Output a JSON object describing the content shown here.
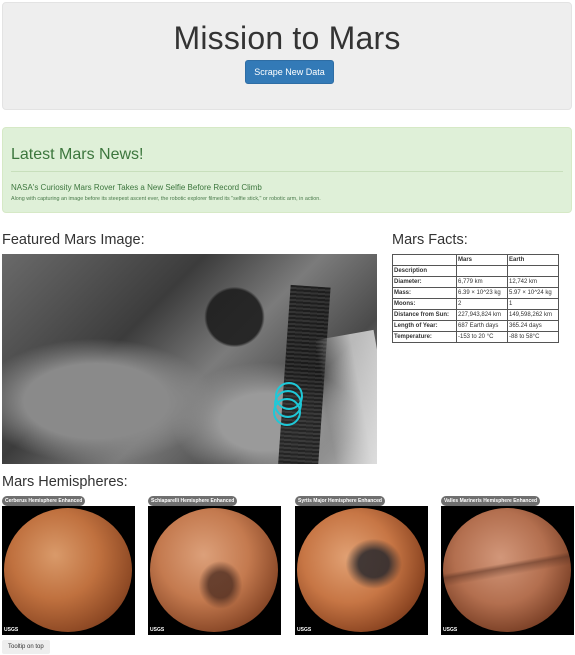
{
  "header": {
    "title": "Mission to Mars",
    "scrape_button": "Scrape New Data"
  },
  "news": {
    "heading": "Latest Mars News!",
    "title": "NASA's Curiosity Mars Rover Takes a New Selfie Before Record Climb",
    "paragraph": "Along with capturing an image before its steepest ascent ever, the robotic explorer filmed its \"selfie stick,\" or robotic arm, in action."
  },
  "featured": {
    "heading": "Featured Mars Image:"
  },
  "facts": {
    "heading": "Mars Facts:",
    "columns": [
      "",
      "Mars",
      "Earth"
    ],
    "index_label": "Description",
    "rows": [
      {
        "label": "Diameter:",
        "mars": "6,779 km",
        "earth": "12,742 km"
      },
      {
        "label": "Mass:",
        "mars": "6.39 × 10^23 kg",
        "earth": "5.97 × 10^24 kg"
      },
      {
        "label": "Moons:",
        "mars": "2",
        "earth": "1"
      },
      {
        "label": "Distance from Sun:",
        "mars": "227,943,824 km",
        "earth": "149,598,262 km"
      },
      {
        "label": "Length of Year:",
        "mars": "687 Earth days",
        "earth": "365.24 days"
      },
      {
        "label": "Temperature:",
        "mars": "-153 to 20 °C",
        "earth": "-88 to 58°C"
      }
    ]
  },
  "hemispheres": {
    "heading": "Mars Hemispheres:",
    "items": [
      {
        "title": "Cerberus Hemisphere Enhanced",
        "logo": "USGS"
      },
      {
        "title": "Schiaparelli Hemisphere Enhanced",
        "logo": "USGS"
      },
      {
        "title": "Syrtis Major Hemisphere Enhanced",
        "logo": "USGS"
      },
      {
        "title": "Valles Marineris Hemisphere Enhanced",
        "logo": "USGS"
      }
    ]
  },
  "tooltip": "Tooltip on top",
  "colors": {
    "primary_button": "#337ab7",
    "news_bg": "#dff0d8",
    "news_text": "#3c763d",
    "jumbotron_bg": "#eeeeee"
  }
}
